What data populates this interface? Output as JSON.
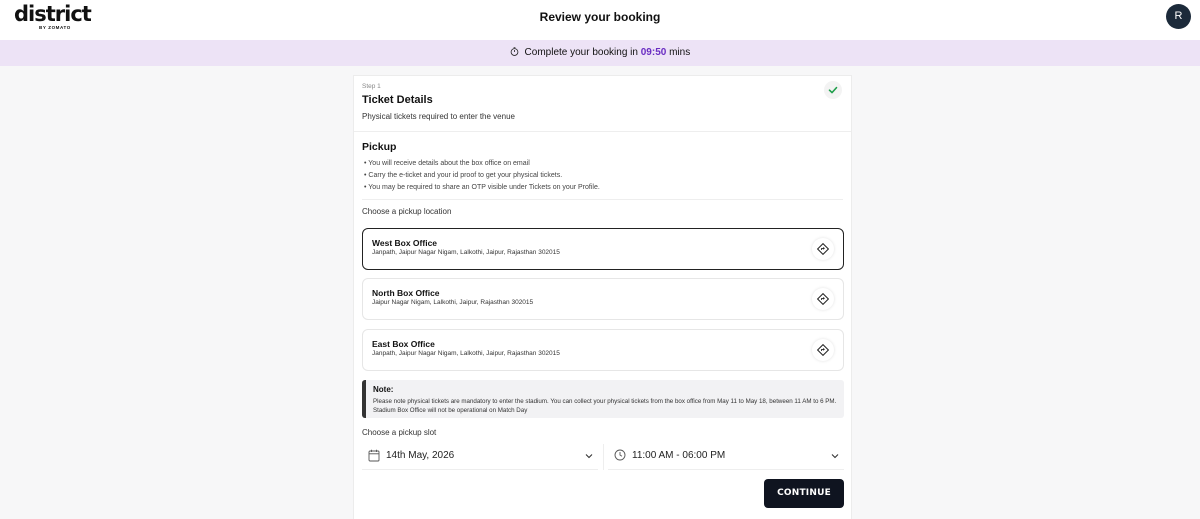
{
  "header": {
    "logo_text": "district",
    "logo_subtext": "BY ZOMATO",
    "title": "Review your booking",
    "avatar_initial": "R"
  },
  "timer": {
    "prefix": "Complete your booking in",
    "time": "09:50",
    "suffix": "mins"
  },
  "step": {
    "label": "Step 1",
    "title": "Ticket Details",
    "subtitle": "Physical tickets required to enter the venue"
  },
  "pickup": {
    "title": "Pickup",
    "bullets": [
      "• You will receive details about the box office on email",
      "• Carry the e-ticket and your id proof to get your physical tickets.",
      "• You may be required to share an OTP visible under Tickets on your Profile."
    ],
    "location_heading": "Choose a pickup location",
    "offices": [
      {
        "name": "West Box Office",
        "address": "Janpath, Jaipur Nagar Nigam, Lalkothi, Jaipur, Rajasthan 302015"
      },
      {
        "name": "North Box Office",
        "address": "Jaipur Nagar Nigam, Lalkothi, Jaipur, Rajasthan 302015"
      },
      {
        "name": "East Box Office",
        "address": "Janpath, Jaipur Nagar Nigam, Lalkothi, Jaipur, Rajasthan 302015"
      }
    ]
  },
  "note": {
    "title": "Note:",
    "text": "Please note physical tickets are mandatory to enter the stadium. You can collect your physical tickets from the box office from May 11 to May 18, between 11 AM to 6 PM. Stadium Box Office will not be operational on Match Day"
  },
  "slot": {
    "heading": "Choose a pickup slot",
    "date": "14th May, 2026",
    "time": "11:00 AM - 06:00 PM"
  },
  "actions": {
    "continue_label": "CONTINUE"
  },
  "colors": {
    "accent_purple": "#6a2dc2",
    "timer_bg": "#ede3f6",
    "button_bg": "#0f1420",
    "check_green": "#1e9e4a"
  }
}
